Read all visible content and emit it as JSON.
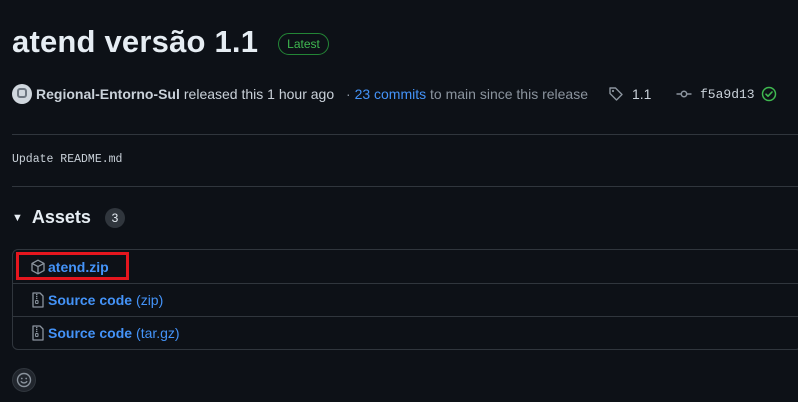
{
  "release": {
    "title": "atend versão 1.1",
    "badge": "Latest"
  },
  "meta": {
    "author": "Regional-Entorno-Sul",
    "released_text": "released this 1 hour ago",
    "commits_prefix": "·",
    "commits_link": "23 commits",
    "commits_suffix": "to main since this release",
    "tag": "1.1",
    "commit_sha": "f5a9d13"
  },
  "notes": "Update README.md",
  "assets": {
    "title": "Assets",
    "count": "3",
    "items": [
      {
        "icon": "package-icon",
        "name": "atend.zip",
        "suffix": ""
      },
      {
        "icon": "file-zip-icon",
        "name": "Source code",
        "suffix": "(zip)"
      },
      {
        "icon": "file-zip-icon",
        "name": "Source code",
        "suffix": "(tar.gz)"
      }
    ]
  },
  "colors": {
    "background": "#0d1117",
    "link": "#4493f8",
    "latest_green": "#3fb950",
    "highlight_red": "#e5161e"
  }
}
